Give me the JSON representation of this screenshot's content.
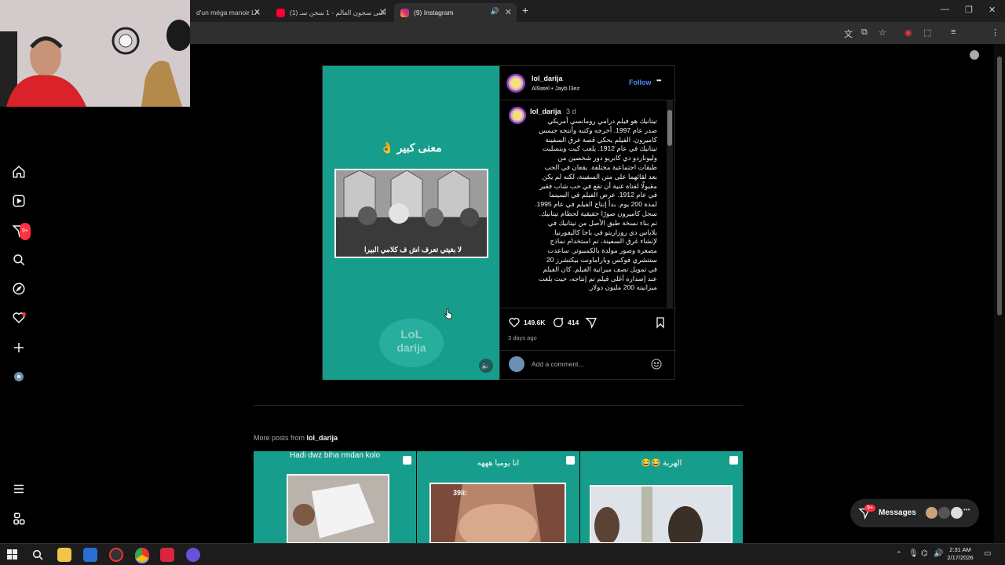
{
  "browser": {
    "tabs": [
      {
        "label": "d'un méga manoir LA"
      },
      {
        "label": "(1) أغنى سجون العالم - 1 سجن سـ"
      },
      {
        "label": "(9) Instagram"
      }
    ],
    "new_tab": "+",
    "controls": {
      "minimize": "—",
      "restore": "❐",
      "close": "✕"
    }
  },
  "nav": {
    "items": [
      {
        "name": "home"
      },
      {
        "name": "reels"
      },
      {
        "name": "direct"
      },
      {
        "name": "search"
      },
      {
        "name": "explore"
      },
      {
        "name": "notifications"
      },
      {
        "name": "create"
      },
      {
        "name": "profile"
      }
    ],
    "direct_badge": "9+",
    "more": "more",
    "also_from_meta": "meta"
  },
  "post": {
    "author": "lol_darija",
    "audio": "Al9atel • Jayb l3ez",
    "follow": "Follow",
    "more": "•••",
    "media": {
      "title": "معنى كبير 👌",
      "subtitle_overlay": "لا بغيتي تعرف اش ف كلامي البيرا",
      "watermark_line1": "LoL",
      "watermark_line2": "darija"
    },
    "caption_author": "lol_darija",
    "caption_time": "3 d",
    "caption_lines": [
      "تيتانيك هو فيلم درامي رومانسي أمريكي",
      "صدر عام 1997. أخرجه وكتبه وأنتجه جيمس",
      "كاميرون. الفيلم يحكي قصة غرق السفينة",
      "تيتانيك في عام 1912. يلعب كيت وينسليت",
      "وليوناردو دي كابريو دور شخصين من",
      "طبقات اجتماعية مختلفة. يقعان في الحب",
      "بعد لقائهما على متن السفينة، لكنه لم يكن",
      "مقبولًا لفتاة غنية أن تقع في حب شاب فقير",
      "في عام 1912. عرض الفيلم في السينما",
      "لمدة 200 يوم. بدأ إنتاج الفيلم في عام 1995.",
      "سجل كاميرون صورًا حقيقية لحطام تيتانيك.",
      "تم بناء نسخة طبق الأصل من تيتانيك في",
      "بلاياس دي روزاريتو في باجا كاليفورنيا.",
      "لإنشاء غرق السفينة، تم استخدام نماذج",
      "مصغرة وصور مولدة بالكمبيوتر. ساعدت",
      "ستتشري فوكس وباراماونت بيكتشرز 20",
      "في تمويل نصف ميزانية الفيلم. كان الفيلم",
      "عند إصداره أغلى فيلم تم إنتاجه، حيث بلغت",
      "ميزانيته 200 مليون دولار."
    ],
    "likes": "149.6K",
    "comments": "414",
    "posted": "3 days ago",
    "comment_placeholder": "Add a comment..."
  },
  "more_posts": {
    "prefix": "More posts from ",
    "author": "lol_darija",
    "tiles": [
      {
        "title": "Hadi dwz biha rmdan kolo"
      },
      {
        "title": "انا يوميا هههه"
      },
      {
        "title": "الهربة 😂😂"
      }
    ],
    "tile2_caption": "39li:"
  },
  "messages": {
    "label": "Messages",
    "badge": "9+"
  },
  "taskbar": {
    "time": "2:31 AM",
    "date": "2/17/2026"
  },
  "colors": {
    "accent": "#169d8c",
    "link": "#4d8dfa",
    "badge": "#ff3040"
  }
}
